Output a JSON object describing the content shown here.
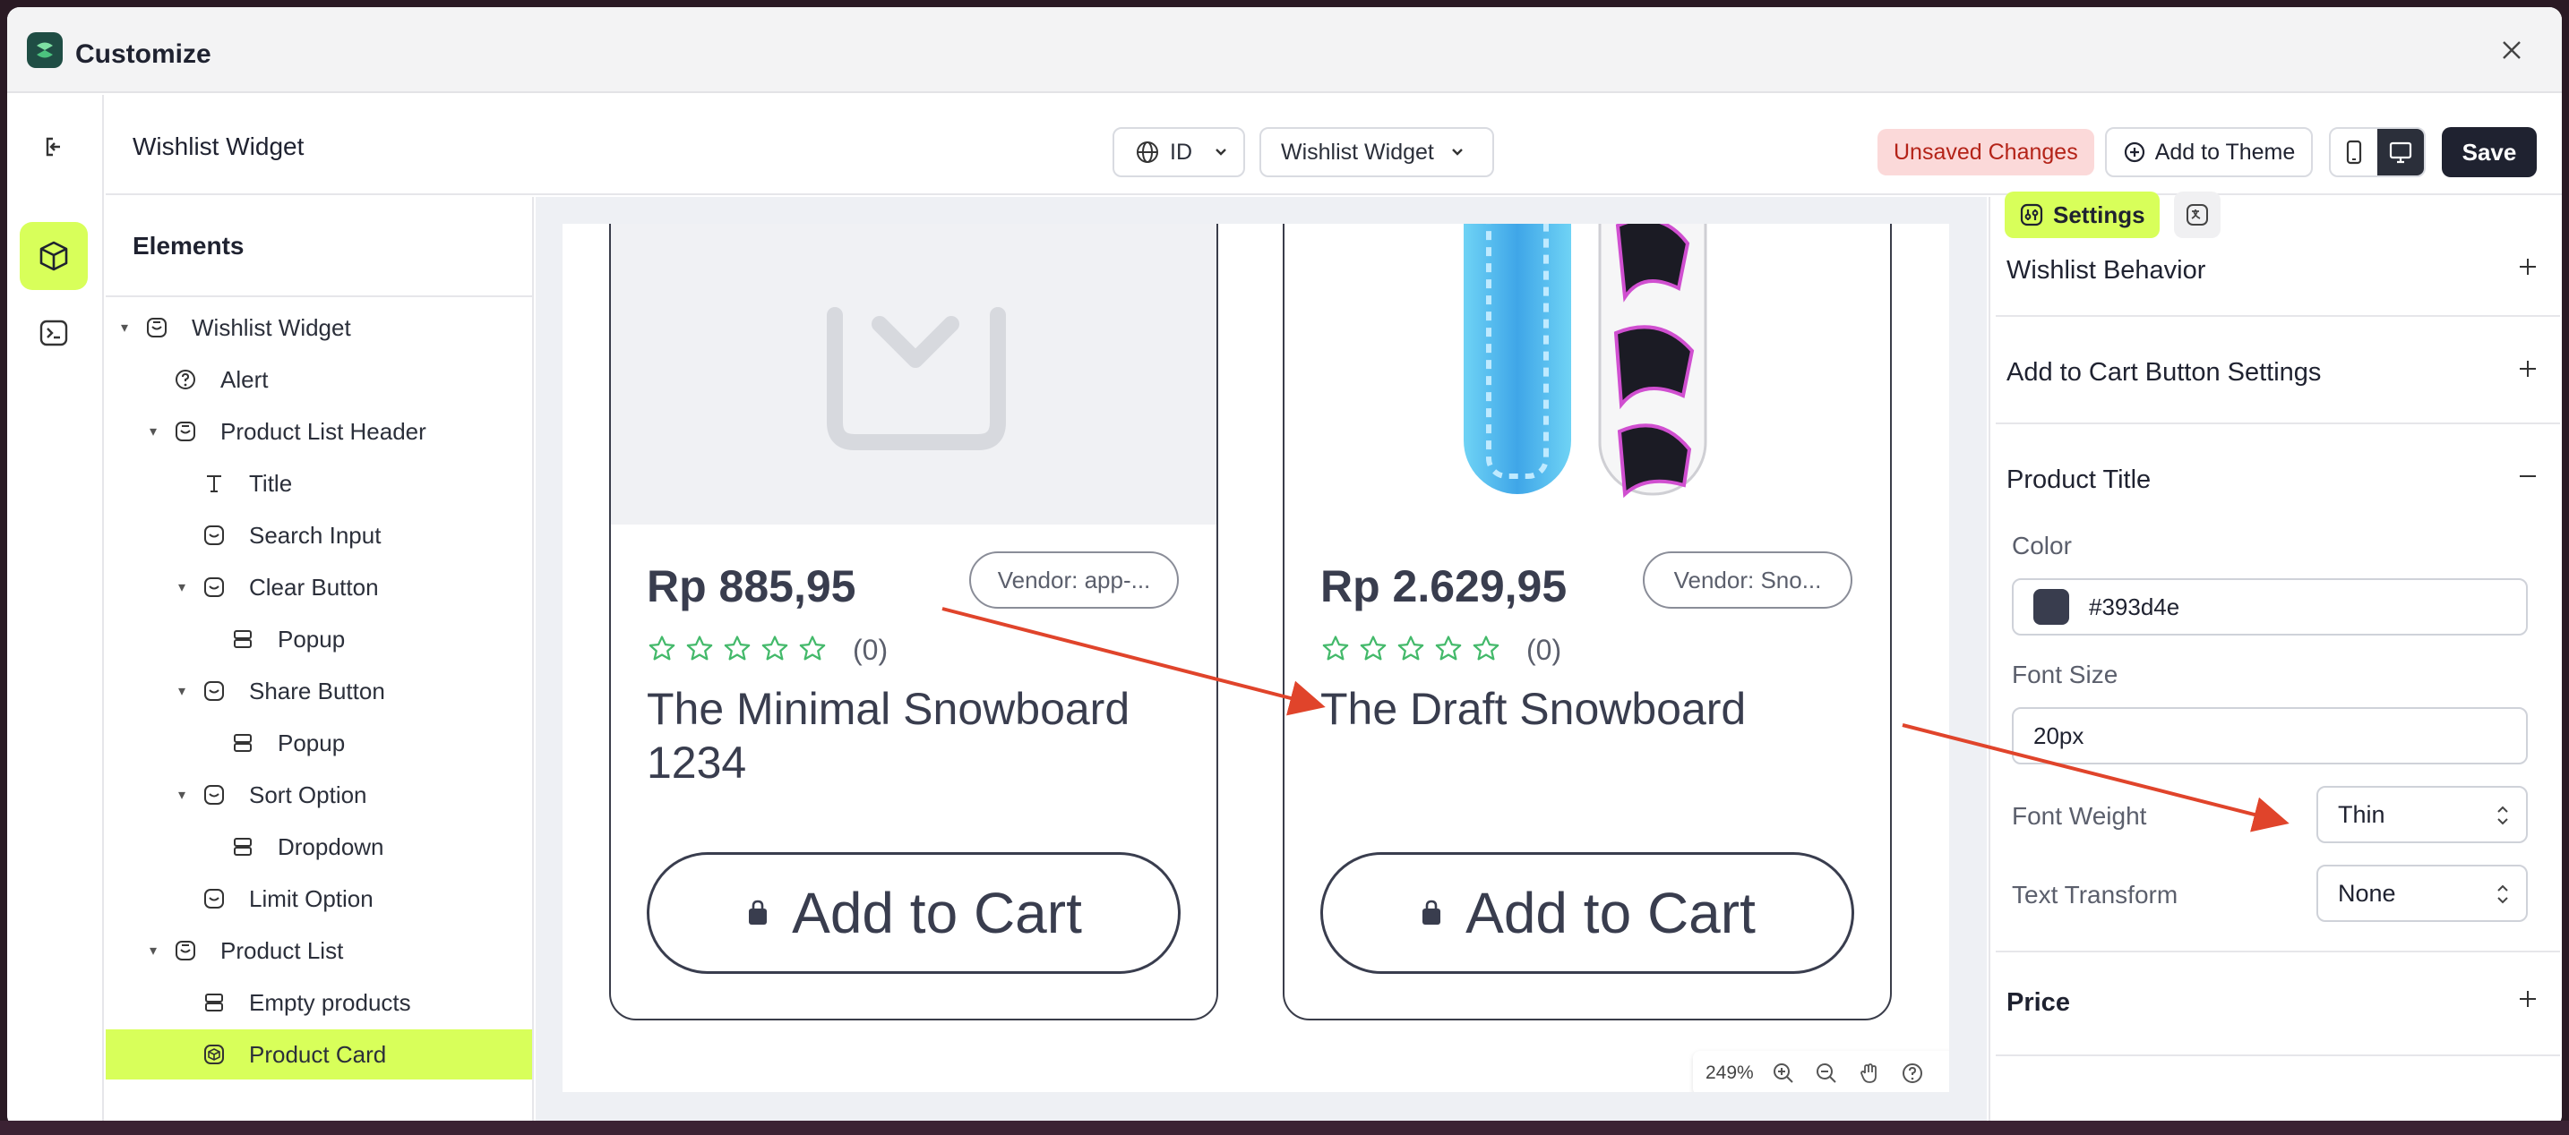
{
  "window": {
    "title": "Customize"
  },
  "toolbar": {
    "page_name": "Wishlist Widget",
    "language": "ID",
    "template": "Wishlist Widget",
    "unsaved_label": "Unsaved Changes",
    "add_to_theme_label": "Add to Theme",
    "save_label": "Save"
  },
  "tree": {
    "header": "Elements",
    "items": [
      {
        "label": "Wishlist Widget",
        "icon": "component-icon"
      },
      {
        "label": "Alert",
        "icon": "help-circle-icon"
      },
      {
        "label": "Product List Header",
        "icon": "component-icon"
      },
      {
        "label": "Title",
        "icon": "text-icon"
      },
      {
        "label": "Search Input",
        "icon": "block-icon"
      },
      {
        "label": "Clear Button",
        "icon": "block-icon"
      },
      {
        "label": "Popup",
        "icon": "layout-icon"
      },
      {
        "label": "Share Button",
        "icon": "block-icon"
      },
      {
        "label": "Popup",
        "icon": "layout-icon"
      },
      {
        "label": "Sort Option",
        "icon": "block-icon"
      },
      {
        "label": "Dropdown",
        "icon": "layout-icon"
      },
      {
        "label": "Limit Option",
        "icon": "block-icon"
      },
      {
        "label": "Product List",
        "icon": "component-icon"
      },
      {
        "label": "Empty products",
        "icon": "layout-icon"
      },
      {
        "label": "Product Card",
        "icon": "cube-icon"
      }
    ]
  },
  "cards": [
    {
      "price": "Rp 885,95",
      "vendor": "Vendor: app-...",
      "reviews": "(0)",
      "title": "The Minimal Snowboard 1234",
      "cta": "Add to Cart"
    },
    {
      "price": "Rp 2.629,95",
      "vendor": "Vendor: Sno...",
      "reviews": "(0)",
      "title": "The Draft Snowboard",
      "cta": "Add to Cart"
    }
  ],
  "zoom": {
    "level": "249%"
  },
  "panel": {
    "tab_settings": "Settings",
    "sections": {
      "wishlist_behavior": "Wishlist Behavior",
      "add_to_cart": "Add to Cart Button Settings",
      "product_title": "Product Title",
      "price": "Price"
    },
    "fields": {
      "color_label": "Color",
      "color_value": "#393d4e",
      "font_size_label": "Font Size",
      "font_size_value": "20px",
      "font_weight_label": "Font Weight",
      "font_weight_value": "Thin",
      "text_transform_label": "Text Transform",
      "text_transform_value": "None"
    }
  },
  "colors": {
    "accent": "#d8ff5a",
    "title_color": "#393d4e",
    "annotation_arrow": "#e0442b",
    "star": "#43b96a"
  }
}
